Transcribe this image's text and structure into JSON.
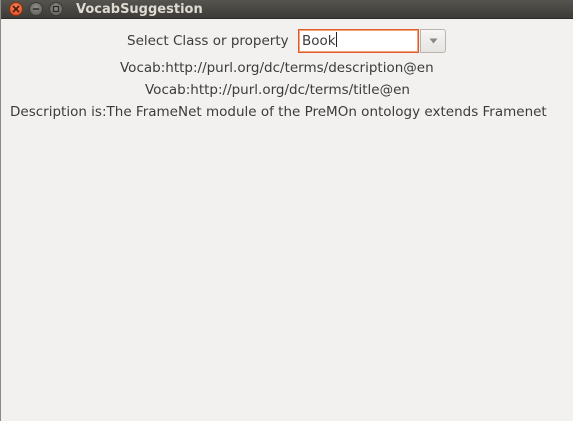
{
  "window": {
    "title": "VocabSuggestion",
    "controls": [
      "close-icon",
      "minimize-icon",
      "maximize-icon"
    ]
  },
  "form": {
    "select_label": "Select Class or property",
    "combo_value": "Book",
    "combo_arrow_icon": "chevron-down-icon"
  },
  "results": {
    "vocab_description": "Vocab:http://purl.org/dc/terms/description@en",
    "vocab_title": "Vocab:http://purl.org/dc/terms/title@en",
    "description": "Description is:The FrameNet module of the PreMOn ontology extends Framenet"
  },
  "colors": {
    "titlebar": "#3c3b37",
    "window_bg": "#f2f1f0",
    "focus_border": "#e05d2a",
    "close_button": "#e0592a"
  }
}
